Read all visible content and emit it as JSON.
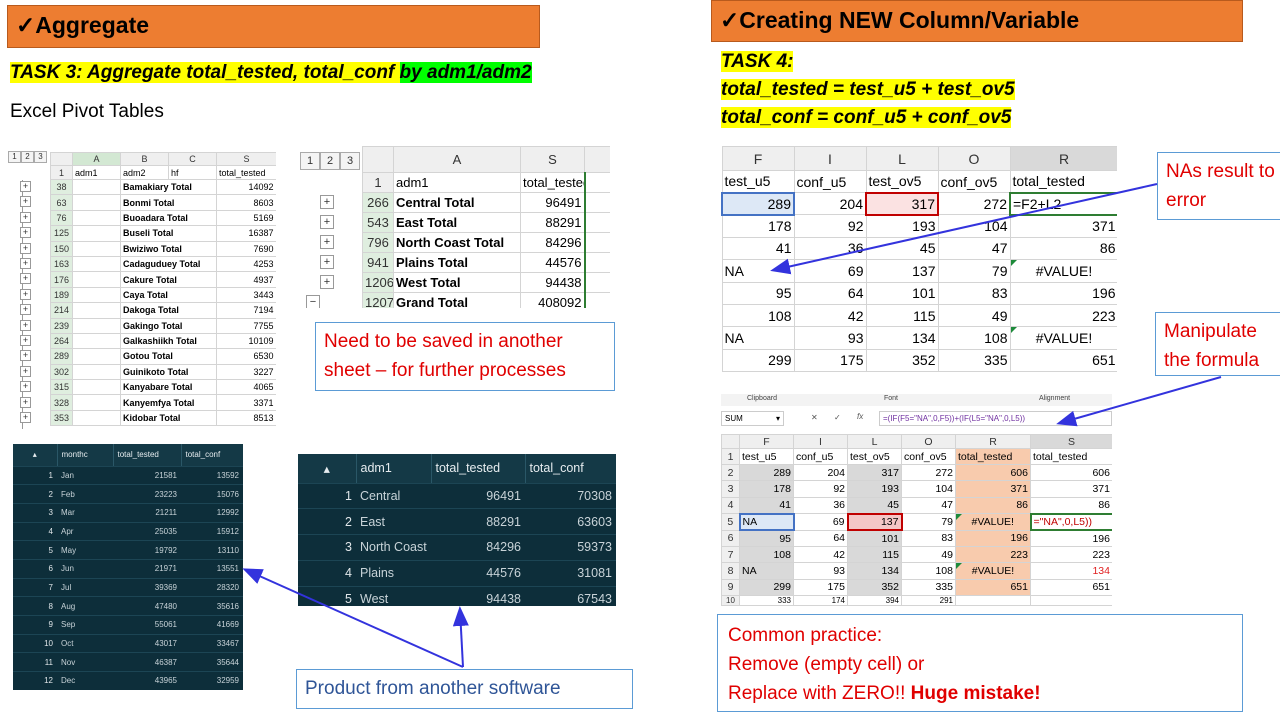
{
  "left": {
    "banner": "✓Aggregate",
    "task3_part1": "TASK 3: Aggregate total_tested, total_conf ",
    "task3_part2": "by adm1/adm2",
    "subtitle": "Excel Pivot Tables",
    "pivot1": {
      "levels": [
        "1",
        "2",
        "3"
      ],
      "columns": [
        "A",
        "B",
        "C",
        "S"
      ],
      "header_row": {
        "rownum": "1",
        "a": "adm1",
        "b": "adm2",
        "c": "hf",
        "s": "total_tested"
      },
      "rows": [
        {
          "rownum": "38",
          "label": "Bamakiary Total",
          "value": "14092"
        },
        {
          "rownum": "63",
          "label": "Bonmi Total",
          "value": "8603"
        },
        {
          "rownum": "76",
          "label": "Buoadara Total",
          "value": "5169"
        },
        {
          "rownum": "125",
          "label": "Buseli Total",
          "value": "16387"
        },
        {
          "rownum": "150",
          "label": "Bwiziwo Total",
          "value": "7690"
        },
        {
          "rownum": "163",
          "label": "Cadaguduey Total",
          "value": "4253"
        },
        {
          "rownum": "176",
          "label": "Cakure Total",
          "value": "4937"
        },
        {
          "rownum": "189",
          "label": "Caya Total",
          "value": "3443"
        },
        {
          "rownum": "214",
          "label": "Dakoga Total",
          "value": "7194"
        },
        {
          "rownum": "239",
          "label": "Gakingo Total",
          "value": "7755"
        },
        {
          "rownum": "264",
          "label": "Galkashiikh Total",
          "value": "10109"
        },
        {
          "rownum": "289",
          "label": "Gotou Total",
          "value": "6530"
        },
        {
          "rownum": "302",
          "label": "Guinikoto Total",
          "value": "3227"
        },
        {
          "rownum": "315",
          "label": "Kanyabare Total",
          "value": "4065"
        },
        {
          "rownum": "328",
          "label": "Kanyemfya Total",
          "value": "3371"
        },
        {
          "rownum": "353",
          "label": "Kidobar Total",
          "value": "8513"
        }
      ]
    },
    "pivot2": {
      "levels": [
        "1",
        "2",
        "3"
      ],
      "columns": [
        "A",
        "S"
      ],
      "header_row": {
        "rownum": "1",
        "a": "adm1",
        "s": "total_tested"
      },
      "rows": [
        {
          "rownum": "266",
          "label": "Central Total",
          "value": "96491"
        },
        {
          "rownum": "543",
          "label": "East Total",
          "value": "88291"
        },
        {
          "rownum": "796",
          "label": "North Coast Total",
          "value": "84296"
        },
        {
          "rownum": "941",
          "label": "Plains Total",
          "value": "44576"
        },
        {
          "rownum": "1206",
          "label": "West Total",
          "value": "94438"
        },
        {
          "rownum": "1207",
          "label": "Grand Total",
          "value": "408092"
        }
      ]
    },
    "note_saved": "Need to be saved in another sheet – for further processes",
    "month_table": {
      "headers": [
        "monthc",
        "total_tested",
        "total_conf"
      ],
      "rows": [
        [
          "1",
          "Jan",
          "21581",
          "13592"
        ],
        [
          "2",
          "Feb",
          "23223",
          "15076"
        ],
        [
          "3",
          "Mar",
          "21211",
          "12992"
        ],
        [
          "4",
          "Apr",
          "25035",
          "15912"
        ],
        [
          "5",
          "May",
          "19792",
          "13110"
        ],
        [
          "6",
          "Jun",
          "21971",
          "13551"
        ],
        [
          "7",
          "Jul",
          "39369",
          "28320"
        ],
        [
          "8",
          "Aug",
          "47480",
          "35616"
        ],
        [
          "9",
          "Sep",
          "55061",
          "41669"
        ],
        [
          "10",
          "Oct",
          "43017",
          "33467"
        ],
        [
          "11",
          "Nov",
          "46387",
          "35644"
        ],
        [
          "12",
          "Dec",
          "43965",
          "32959"
        ]
      ]
    },
    "adm_table": {
      "headers": [
        "adm1",
        "total_tested",
        "total_conf"
      ],
      "rows": [
        [
          "1",
          "Central",
          "96491",
          "70308"
        ],
        [
          "2",
          "East",
          "88291",
          "63603"
        ],
        [
          "3",
          "North Coast",
          "84296",
          "59373"
        ],
        [
          "4",
          "Plains",
          "44576",
          "31081"
        ],
        [
          "5",
          "West",
          "94438",
          "67543"
        ]
      ]
    },
    "note_product": "Product from another software"
  },
  "right": {
    "banner": "✓Creating NEW Column/Variable",
    "task4_title": "TASK 4:",
    "task4_line1": "total_tested = test_u5 + test_ov5",
    "task4_line2": "total_conf = conf_u5 + conf_ov5",
    "sheet1": {
      "columns": [
        "F",
        "I",
        "L",
        "O",
        "R"
      ],
      "header_row": [
        "test_u5",
        "conf_u5",
        "test_ov5",
        "conf_ov5",
        "total_tested"
      ],
      "rows": [
        [
          "289",
          "204",
          "317",
          "272",
          "=F2+L2"
        ],
        [
          "178",
          "92",
          "193",
          "104",
          "371"
        ],
        [
          "41",
          "36",
          "45",
          "47",
          "86"
        ],
        [
          "NA",
          "69",
          "137",
          "79",
          "#VALUE!"
        ],
        [
          "95",
          "64",
          "101",
          "83",
          "196"
        ],
        [
          "108",
          "42",
          "115",
          "49",
          "223"
        ],
        [
          "NA",
          "93",
          "134",
          "108",
          "#VALUE!"
        ],
        [
          "299",
          "175",
          "352",
          "335",
          "651"
        ]
      ]
    },
    "callout_na": "NAs result to error",
    "callout_manip": "Manipulate the formula",
    "sheet2": {
      "ribbon": [
        "Clipboard",
        "Font",
        "Alignment"
      ],
      "namebox": "SUM",
      "formula": "=(IF(F5=\"NA\",0,F5))+(IF(L5=\"NA\",0,L5))",
      "columns": [
        "F",
        "I",
        "L",
        "O",
        "R",
        "S"
      ],
      "header_row": [
        "test_u5",
        "conf_u5",
        "test_ov5",
        "conf_ov5",
        "total_tested",
        "total_tested"
      ],
      "rows": [
        [
          "2",
          "289",
          "204",
          "317",
          "272",
          "606",
          "606"
        ],
        [
          "3",
          "178",
          "92",
          "193",
          "104",
          "371",
          "371"
        ],
        [
          "4",
          "41",
          "36",
          "45",
          "47",
          "86",
          "86"
        ],
        [
          "5",
          "NA",
          "69",
          "137",
          "79",
          "#VALUE!",
          "=\"NA\",0,L5))"
        ],
        [
          "6",
          "95",
          "64",
          "101",
          "83",
          "196",
          "196"
        ],
        [
          "7",
          "108",
          "42",
          "115",
          "49",
          "223",
          "223"
        ],
        [
          "8",
          "NA",
          "93",
          "134",
          "108",
          "#VALUE!",
          "134"
        ],
        [
          "9",
          "299",
          "175",
          "352",
          "335",
          "651",
          "651"
        ]
      ],
      "partial_row": [
        "10",
        "333",
        "174",
        "394",
        "291"
      ]
    },
    "common": {
      "line1": "Common practice:",
      "line2": "Remove (empty cell) or",
      "line3a": "Replace with ZERO!! ",
      "line3b": "Huge mistake!"
    }
  }
}
